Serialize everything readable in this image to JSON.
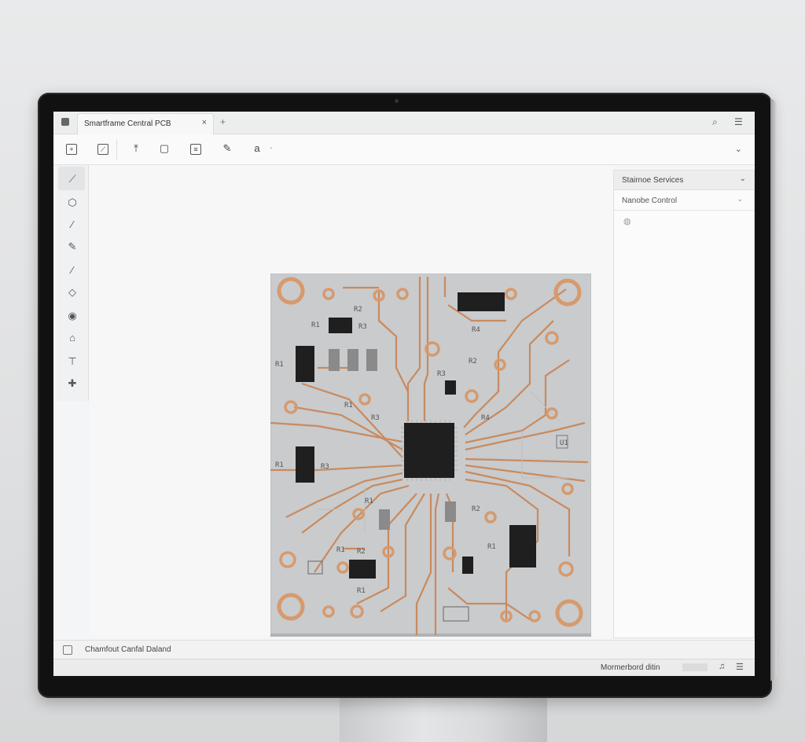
{
  "window": {
    "tab_title": "Smartframe Central PCB",
    "tab_close": "×",
    "tab_add": "+",
    "search_icon": "⌕",
    "menu_icon": "☰"
  },
  "toolbar": {
    "more": "·",
    "dropdown": "⌄"
  },
  "right_panel": {
    "header": "Stairnoe Services",
    "header_chevron": "⌄",
    "row_label": "Nanobe Control",
    "row_chevron": "⌄"
  },
  "console": {
    "label": "Chamfout Canfal Daland"
  },
  "status": {
    "label": "Mormerbord ditin",
    "bell": "♫",
    "menu": "☰"
  },
  "pcb": {
    "labels": [
      "R1",
      "R3",
      "R2",
      "R1",
      "R4",
      "R2",
      "R3",
      "R1",
      "R3",
      "R4",
      "R1",
      "R3",
      "R1",
      "R2",
      "R1",
      "U1",
      "R1",
      "R2",
      "R1"
    ]
  },
  "colors": {
    "board": "#c9cbcd",
    "trace": "#c98a5e",
    "pad": "#d69a6e",
    "chip": "#1f1f1f"
  }
}
